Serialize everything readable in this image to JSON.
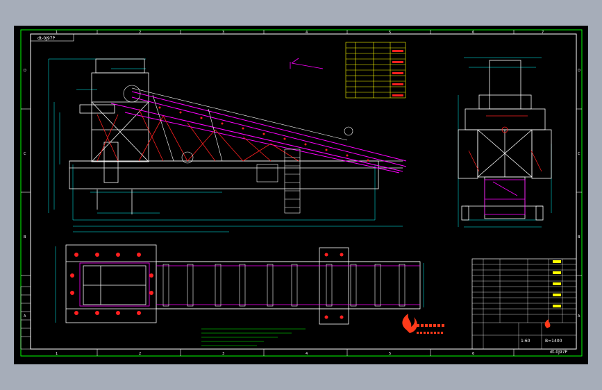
{
  "drawing": {
    "code_top": "dt-0J97P",
    "code_bottom": "dt-0J97P",
    "scale": "1:60",
    "sheet_ref": "B=1400"
  },
  "border": {
    "column_labels": [
      "1",
      "2",
      "3",
      "4",
      "5",
      "6",
      "7",
      "8"
    ],
    "row_labels": [
      "D",
      "C",
      "B",
      "A"
    ]
  },
  "logo": {
    "name": "company-logo"
  },
  "colors": {
    "background": "#000000",
    "frame": "#00ff00",
    "structure": "#ffffff",
    "belt": "#ff00ff",
    "dimension": "#00ffff",
    "highlight": "#ff2020",
    "note": "#ffff00",
    "outside": "#a6adb9"
  }
}
